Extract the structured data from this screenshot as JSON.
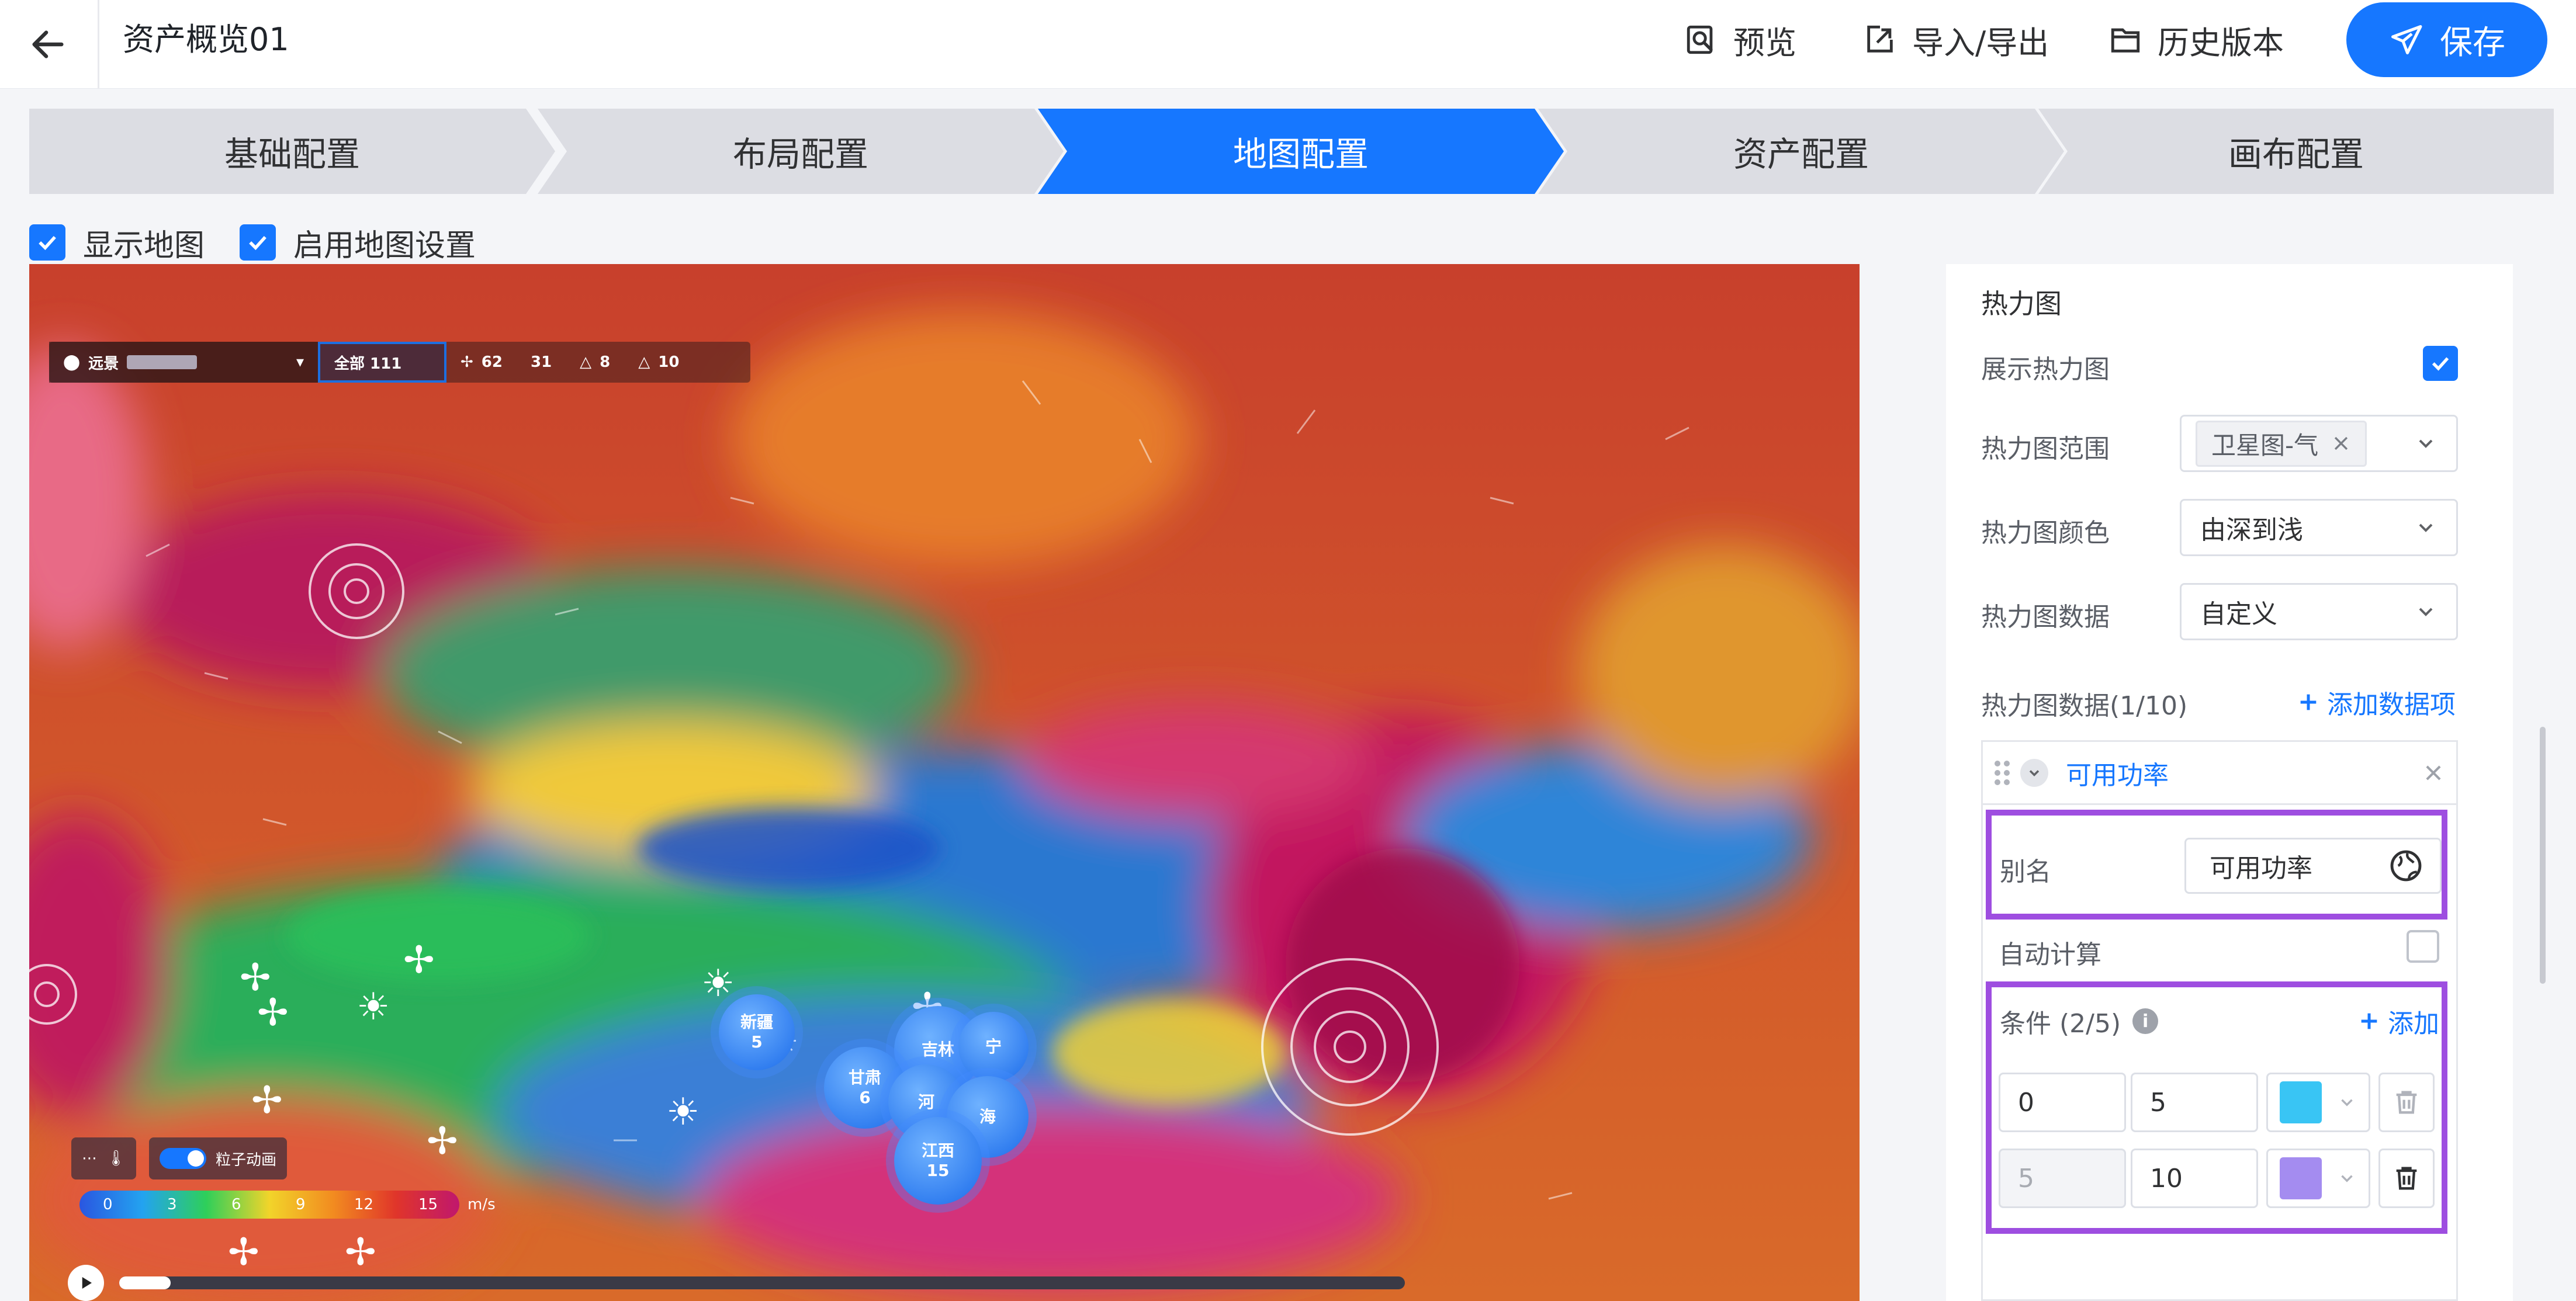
{
  "header": {
    "title": "资产概览01",
    "actions": [
      {
        "label": "预览",
        "icon": "preview-icon"
      },
      {
        "label": "导入/导出",
        "icon": "import-export-icon"
      },
      {
        "label": "历史版本",
        "icon": "folder-icon"
      }
    ],
    "save_label": "保存"
  },
  "steps": [
    {
      "label": "基础配置",
      "active": false
    },
    {
      "label": "布局配置",
      "active": false
    },
    {
      "label": "地图配置",
      "active": true
    },
    {
      "label": "资产配置",
      "active": false
    },
    {
      "label": "画布配置",
      "active": false
    }
  ],
  "checkboxes": {
    "show_map": {
      "label": "显示地图",
      "checked": true
    },
    "enable_map_settings": {
      "label": "启用地图设置",
      "checked": true
    }
  },
  "map": {
    "toolbar": {
      "location_label": "远景",
      "all_label": "全部 111",
      "counts": [
        "62",
        "31",
        "8",
        "10"
      ]
    },
    "clusters": [
      {
        "name": "新疆",
        "count": "5"
      },
      {
        "name": "甘肃",
        "count": "6"
      },
      {
        "name": "江西",
        "count": "15"
      },
      {
        "name": "河",
        "count": ""
      },
      {
        "name": "吉林",
        "count": ""
      },
      {
        "name": "宁",
        "count": ""
      },
      {
        "name": "海",
        "count": ""
      }
    ],
    "particle_label": "粒子动画",
    "wind_scale": [
      "0",
      "3",
      "6",
      "9",
      "12",
      "15"
    ],
    "wind_unit": "m/s",
    "timeline_progress": 0.04
  },
  "panel": {
    "section_title": "热力图",
    "show_heatmap": {
      "label": "展示热力图",
      "checked": true
    },
    "range": {
      "label": "热力图范围",
      "tag": "卫星图-气"
    },
    "color": {
      "label": "热力图颜色",
      "value": "由深到浅"
    },
    "data": {
      "label": "热力图数据",
      "value": "自定义"
    },
    "data_items": {
      "label": "热力图数据(1/10)",
      "add_label": "添加数据项"
    },
    "item": {
      "name": "可用功率",
      "alias_label": "别名",
      "alias_value": "可用功率",
      "auto_calc_label": "自动计算",
      "auto_calc_checked": false,
      "conditions_label": "条件 (2/5)",
      "add_label": "添加",
      "conditions": [
        {
          "min": "0",
          "max": "5",
          "color": "#39c5f4",
          "min_disabled": false
        },
        {
          "min": "5",
          "max": "10",
          "color": "#a48cf0",
          "min_disabled": true
        }
      ]
    }
  }
}
